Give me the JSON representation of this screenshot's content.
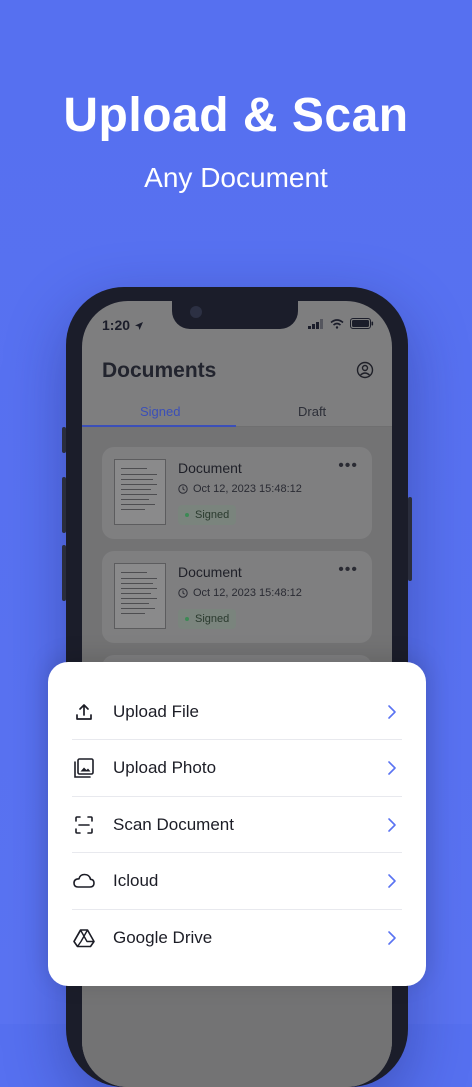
{
  "hero": {
    "title": "Upload & Scan",
    "subtitle": "Any Document"
  },
  "status_bar": {
    "time": "1:20"
  },
  "app": {
    "title": "Documents",
    "tabs": [
      {
        "label": "Signed",
        "active": true
      },
      {
        "label": "Draft",
        "active": false
      }
    ],
    "documents": [
      {
        "name": "Document",
        "date": "Oct 12, 2023 15:48:12",
        "status": "Signed"
      },
      {
        "name": "Document",
        "date": "Oct 12, 2023 15:48:12",
        "status": "Signed"
      }
    ]
  },
  "sheet": {
    "items": [
      {
        "label": "Upload File",
        "icon": "upload-icon"
      },
      {
        "label": "Upload Photo",
        "icon": "photo-library-icon"
      },
      {
        "label": "Scan Document",
        "icon": "scan-icon"
      },
      {
        "label": "Icloud",
        "icon": "cloud-icon"
      },
      {
        "label": "Google Drive",
        "icon": "google-drive-icon"
      }
    ]
  },
  "colors": {
    "background": "#5670f0",
    "accent": "#3b4fb8",
    "chevron": "#5a73f2",
    "sheet": "#ffffff"
  }
}
